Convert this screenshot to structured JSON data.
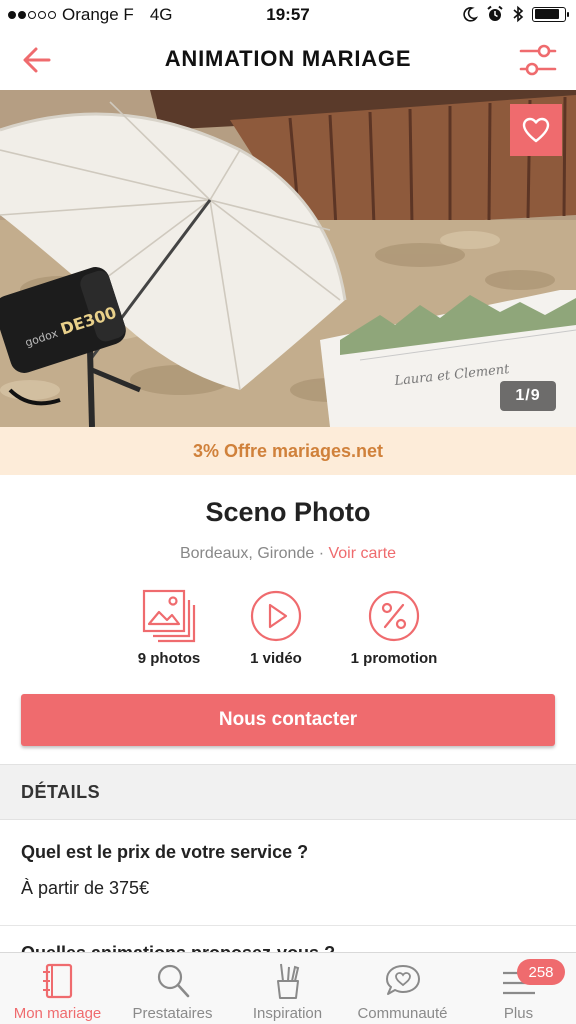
{
  "status_bar": {
    "carrier": "Orange F",
    "network": "4G",
    "time": "19:57",
    "signal_bars_filled": 2,
    "signal_bars_total": 5
  },
  "nav": {
    "title": "ANIMATION MARIAGE",
    "back_icon": "arrow-left-icon",
    "filter_icon": "sliders-icon"
  },
  "hero": {
    "photo_counter": "1/9",
    "favorite_icon": "heart-icon"
  },
  "promo": {
    "text": "3% Offre mariages.net"
  },
  "vendor": {
    "name": "Sceno Photo",
    "location": "Bordeaux, Gironde",
    "separator": " · ",
    "map_link": "Voir carte"
  },
  "media": [
    {
      "label": "9 photos",
      "icon": "photos-icon"
    },
    {
      "label": "1 vidéo",
      "icon": "play-icon"
    },
    {
      "label": "1 promotion",
      "icon": "percent-icon"
    }
  ],
  "contact_button": "Nous contacter",
  "details": {
    "header": "DÉTAILS",
    "q1": "Quel est le prix de votre service ?",
    "a1": "À partir de 375€",
    "q2": "Quelles animations proposez-vous ?"
  },
  "tabs": [
    {
      "label": "Mon mariage",
      "icon": "notebook-icon",
      "active": true
    },
    {
      "label": "Prestataires",
      "icon": "search-icon",
      "active": false
    },
    {
      "label": "Inspiration",
      "icon": "inspiration-icon",
      "active": false
    },
    {
      "label": "Communauté",
      "icon": "chat-heart-icon",
      "active": false
    },
    {
      "label": "Plus",
      "icon": "menu-icon",
      "active": false,
      "badge": "258"
    }
  ],
  "colors": {
    "accent": "#ef6b6e",
    "promo_bg": "#fdecd9",
    "promo_text": "#d0813b"
  }
}
